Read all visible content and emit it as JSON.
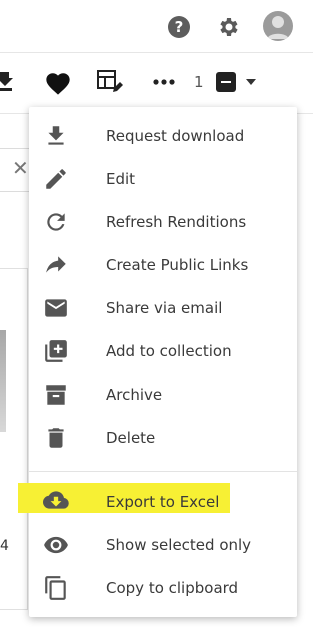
{
  "toolbar": {
    "selected_count": "1"
  },
  "background": {
    "card_fragment_text": "4"
  },
  "menu": {
    "items": [
      {
        "label": "Request download",
        "icon": "download-icon"
      },
      {
        "label": "Edit",
        "icon": "pencil-icon"
      },
      {
        "label": "Refresh Renditions",
        "icon": "refresh-icon"
      },
      {
        "label": "Create Public Links",
        "icon": "share-arrow-icon"
      },
      {
        "label": "Share via email",
        "icon": "envelope-icon"
      },
      {
        "label": "Add to collection",
        "icon": "add-to-collection-icon"
      },
      {
        "label": "Archive",
        "icon": "archive-icon"
      },
      {
        "label": "Delete",
        "icon": "trash-icon"
      },
      {
        "label": "Export to Excel",
        "icon": "cloud-download-icon",
        "highlighted": true
      },
      {
        "label": "Show selected only",
        "icon": "eye-icon"
      },
      {
        "label": "Copy to clipboard",
        "icon": "copy-icon"
      }
    ]
  },
  "colors": {
    "highlight": "#f7f034",
    "icon": "#555555",
    "text": "#3a3a3a"
  }
}
